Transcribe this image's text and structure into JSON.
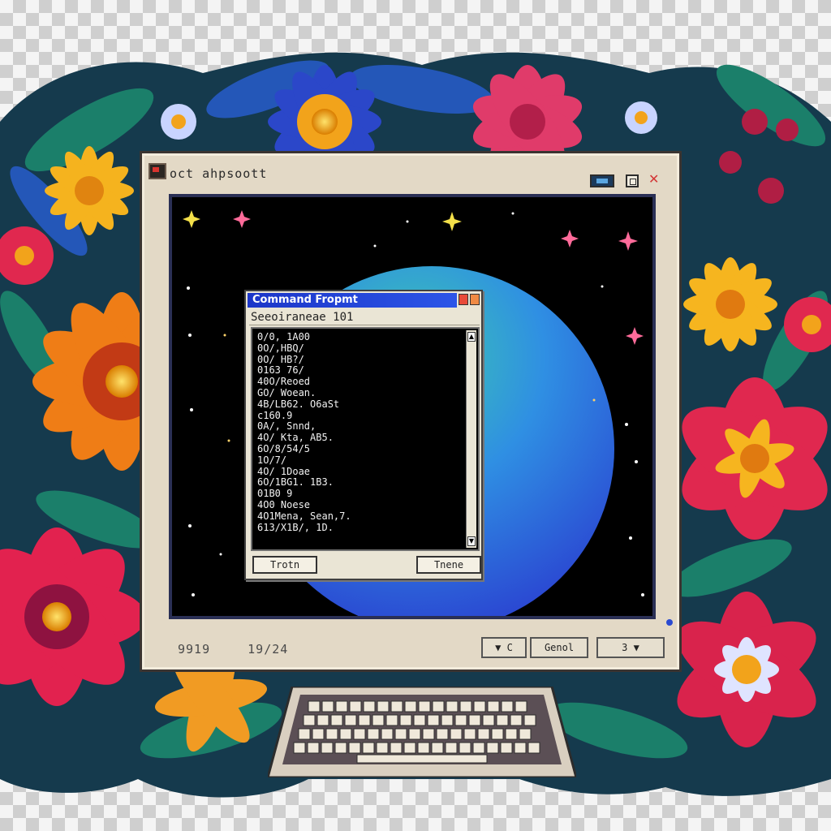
{
  "window": {
    "title": "oct ahpsoott",
    "footer_left": [
      "9919",
      "19/24"
    ],
    "footer_buttons": [
      "▼ C",
      "Genol",
      "3 ▼"
    ],
    "close_glyph": "✕"
  },
  "command_prompt": {
    "title": "Command Fropmt",
    "subtitle": "Seeoiraneae 101",
    "lines": [
      "0/0, 1A00",
      "0O/,HBQ/",
      "0O/ HB?/",
      "0163 76/",
      "40O/Reoed",
      "GO/ Woean.",
      "4B/LB62. O6aSt",
      "c160.9",
      "0A/, Snnd,",
      "4O/ Kta, AB5.",
      "6O/8/54/5",
      "1O/7/",
      "4O/ 1Doae",
      "6O/1BG1. 1B3.",
      "01B0 9",
      "4O0 Noese",
      "4O1Mena, Sean,7.",
      "613/X1B/, 1D."
    ],
    "buttons": [
      "Trotn",
      "Tnene"
    ]
  },
  "colors": {
    "cmd_title_bar": "#1c36c8",
    "planet": "#2f63e0",
    "monitor_bezel": "#e3d9c6"
  }
}
